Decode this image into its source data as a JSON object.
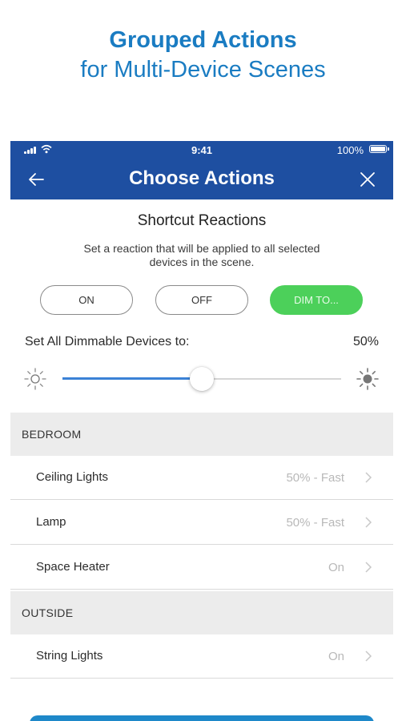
{
  "promo": {
    "title": "Grouped Actions",
    "subtitle": "for Multi-Device Scenes",
    "color": "#1a7cc2"
  },
  "status_bar": {
    "time": "9:41",
    "battery": "100%"
  },
  "header": {
    "title": "Choose Actions",
    "back_icon": "arrow-left-icon",
    "close_icon": "close-icon",
    "color": "#1e4fa1"
  },
  "shortcut": {
    "title": "Shortcut Reactions",
    "description": "Set a reaction that will be applied to all selected devices in the scene.",
    "buttons": [
      {
        "label": "ON",
        "selected": false
      },
      {
        "label": "OFF",
        "selected": false
      },
      {
        "label": "DIM TO...",
        "selected": true,
        "color": "#4cd05a"
      }
    ]
  },
  "dimmer": {
    "label": "Set All Dimmable Devices to:",
    "value_label": "50%",
    "value": 0.5,
    "low_icon": "sun-dim-icon",
    "high_icon": "sun-bright-icon",
    "accent": "#3b82d6"
  },
  "groups": [
    {
      "name": "BEDROOM",
      "devices": [
        {
          "name": "Ceiling Lights",
          "value": "50% - Fast"
        },
        {
          "name": "Lamp",
          "value": "50% - Fast"
        },
        {
          "name": "Space Heater",
          "value": "On"
        }
      ]
    },
    {
      "name": "OUTSIDE",
      "devices": [
        {
          "name": "String Lights",
          "value": "On"
        }
      ]
    }
  ]
}
